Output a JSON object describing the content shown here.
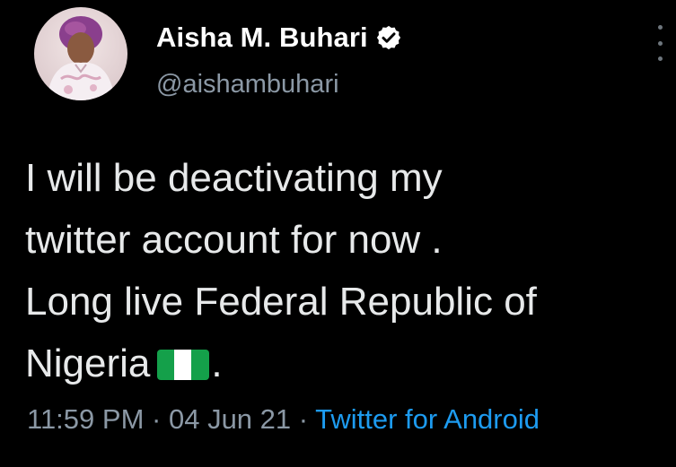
{
  "author": {
    "display_name": "Aisha M. Buhari",
    "handle": "@aishambuhari",
    "verified": true,
    "verified_icon": "verified-badge-icon"
  },
  "tweet": {
    "lines": [
      "I will be deactivating my",
      "twitter account for now .",
      "Long live Federal Republic of",
      "Nigeria"
    ],
    "trailing_text": ".",
    "emoji": "nigeria-flag"
  },
  "meta": {
    "time": "11:59 PM",
    "separator": "·",
    "date": "04 Jun 21",
    "source": "Twitter for Android"
  },
  "colors": {
    "background": "#000000",
    "text": "#e7e9ea",
    "secondary": "#8b98a5",
    "link": "#1d9bf0",
    "flag_green": "#14a04a",
    "flag_white": "#ffffff"
  }
}
